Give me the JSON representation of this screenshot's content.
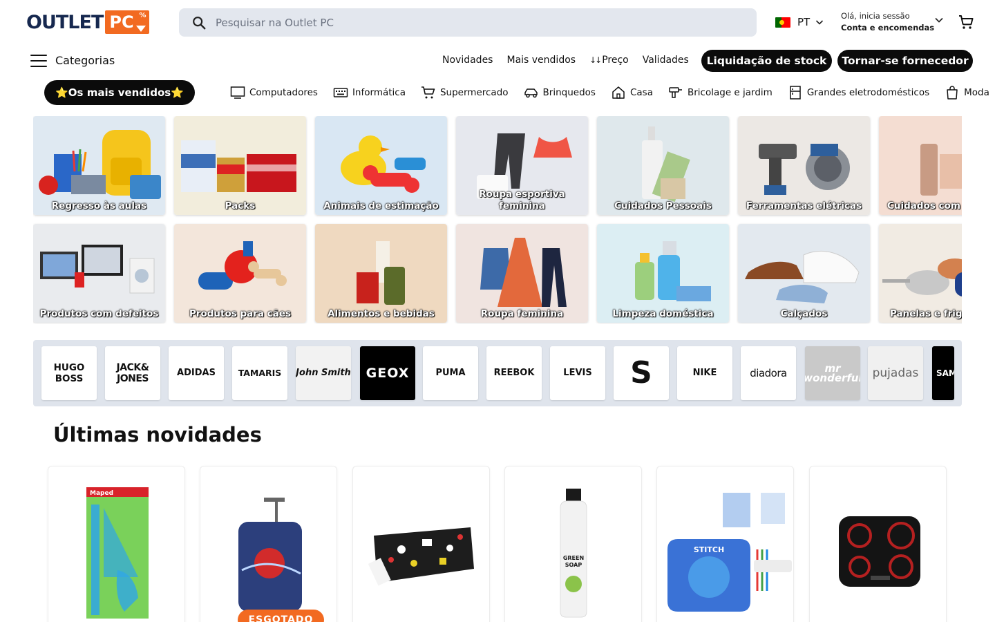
{
  "header": {
    "logo_text": "OUTLET",
    "logo_accent": "PC",
    "logo_percent": "%",
    "search_placeholder": "Pesquisar na Outlet PC",
    "lang_code": "PT",
    "greeting": "Olá, inicia sessão",
    "account_label": "Conta e encomendas"
  },
  "nav": {
    "categories_label": "Categorias",
    "links": [
      "Novidades",
      "Mais vendidos",
      "Preço",
      "Validades"
    ],
    "sort_icon": "↓↓",
    "liquidation_label": "Liquidação de stock",
    "supplier_label": "Tornar-se fornecedor"
  },
  "category_bar": {
    "bestsellers_label": "⭐Os mais vendidos⭐",
    "items": [
      {
        "label": "Computadores",
        "icon": "monitor-icon"
      },
      {
        "label": "Informática",
        "icon": "keyboard-icon"
      },
      {
        "label": "Supermercado",
        "icon": "cart-icon"
      },
      {
        "label": "Brinquedos",
        "icon": "toy-car-icon"
      },
      {
        "label": "Casa",
        "icon": "house-icon"
      },
      {
        "label": "Bricolage e jardim",
        "icon": "drill-icon"
      },
      {
        "label": "Grandes eletrodomésticos",
        "icon": "fridge-icon"
      },
      {
        "label": "Moda",
        "icon": "bag-icon"
      }
    ]
  },
  "tiles": {
    "row1": [
      {
        "label": "Regresso às aulas"
      },
      {
        "label": "Packs"
      },
      {
        "label": "Animais de estimação"
      },
      {
        "label": "Roupa esportiva feminina"
      },
      {
        "label": "Cuidados Pessoais"
      },
      {
        "label": "Ferramentas elétricas"
      },
      {
        "label": "Cuidados com"
      }
    ],
    "row2": [
      {
        "label": "Produtos com defeitos"
      },
      {
        "label": "Produtos para cães"
      },
      {
        "label": "Alimentos e bebidas"
      },
      {
        "label": "Roupa feminina"
      },
      {
        "label": "Limpeza doméstica"
      },
      {
        "label": "Calçados"
      },
      {
        "label": "Panelas e frig"
      }
    ]
  },
  "brands": [
    {
      "name": "HUGO\nBOSS"
    },
    {
      "name": "JACK&\nJONES"
    },
    {
      "name": "ADIDAS"
    },
    {
      "name": "TAMARIS"
    },
    {
      "name": "John Smith"
    },
    {
      "name": "GEOX"
    },
    {
      "name": "PUMA"
    },
    {
      "name": "REEBOK"
    },
    {
      "name": "LEVIS"
    },
    {
      "name": "S"
    },
    {
      "name": "NIKE"
    },
    {
      "name": "diadora"
    },
    {
      "name": "mr wonderful"
    },
    {
      "name": "pujadas"
    },
    {
      "name": "SAM"
    }
  ],
  "latest": {
    "title": "Últimas novidades",
    "sold_out_badge": "ESGOTADO",
    "products": [
      {
        "name": "maped-ruler-set",
        "brand_text": "Maped"
      },
      {
        "name": "spiderman-suitcase"
      },
      {
        "name": "pencil-case"
      },
      {
        "name": "green-soap-detergent",
        "brand_text": "Marcel's GREEN SOAP"
      },
      {
        "name": "stitch-backpack-set",
        "brand_text": "STITCH"
      },
      {
        "name": "induction-hob"
      }
    ]
  },
  "colors": {
    "brand_navy": "#16284f",
    "brand_orange": "#f26a21",
    "pill_black": "#0b0b0b",
    "search_bg": "#e3e7ee",
    "brands_bg": "#dfe4ec"
  }
}
